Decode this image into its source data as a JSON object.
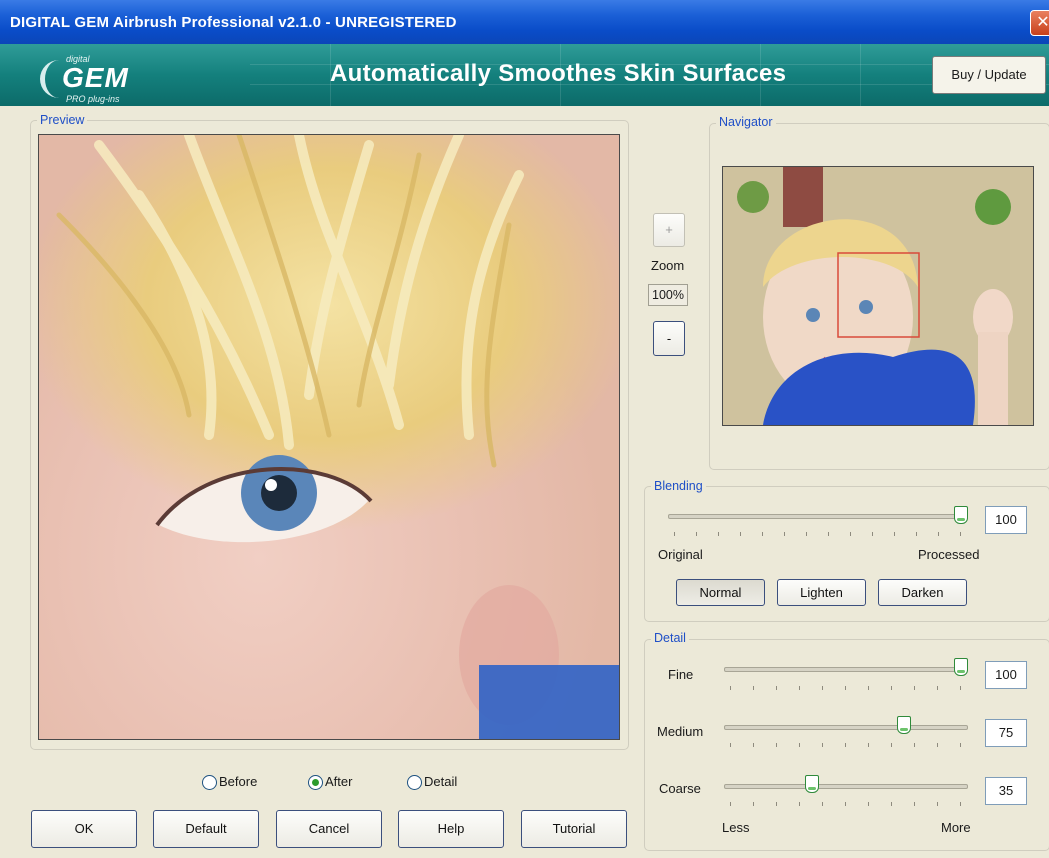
{
  "window": {
    "title": "DIGITAL GEM Airbrush Professional v2.1.0 - UNREGISTERED",
    "close_glyph": "✕"
  },
  "banner": {
    "logo_small": "digital",
    "logo_main": "GEM",
    "logo_sub": "PRO plug-ins",
    "slogan": "Automatically Smoothes Skin Surfaces",
    "buy_label": "Buy / Update"
  },
  "preview": {
    "legend": "Preview",
    "view_options": [
      {
        "label": "Before",
        "selected": false
      },
      {
        "label": "After",
        "selected": true
      },
      {
        "label": "Detail",
        "selected": false
      }
    ]
  },
  "zoom": {
    "label": "Zoom",
    "value": "100%",
    "plus": "+",
    "minus": "-"
  },
  "navigator": {
    "legend": "Navigator"
  },
  "blending": {
    "legend": "Blending",
    "value": "100",
    "level": 100,
    "left_label": "Original",
    "right_label": "Processed",
    "modes": [
      "Normal",
      "Lighten",
      "Darken"
    ],
    "active_mode": "Normal"
  },
  "detail": {
    "legend": "Detail",
    "sliders": [
      {
        "label": "Fine",
        "value": "100",
        "level": 100
      },
      {
        "label": "Medium",
        "value": "75",
        "level": 75
      },
      {
        "label": "Coarse",
        "value": "35",
        "level": 35
      }
    ],
    "left_label": "Less",
    "right_label": "More"
  },
  "footer": {
    "buttons": [
      "OK",
      "Default",
      "Cancel",
      "Help",
      "Tutorial"
    ]
  },
  "colors": {
    "titlebar": "#0a4cc8",
    "banner": "#14807d",
    "legend_text": "#1f4fc7",
    "dialog_bg": "#ece9d8"
  },
  "icons": {
    "close": "close-icon",
    "plus": "plus-icon",
    "minus": "minus-icon"
  }
}
